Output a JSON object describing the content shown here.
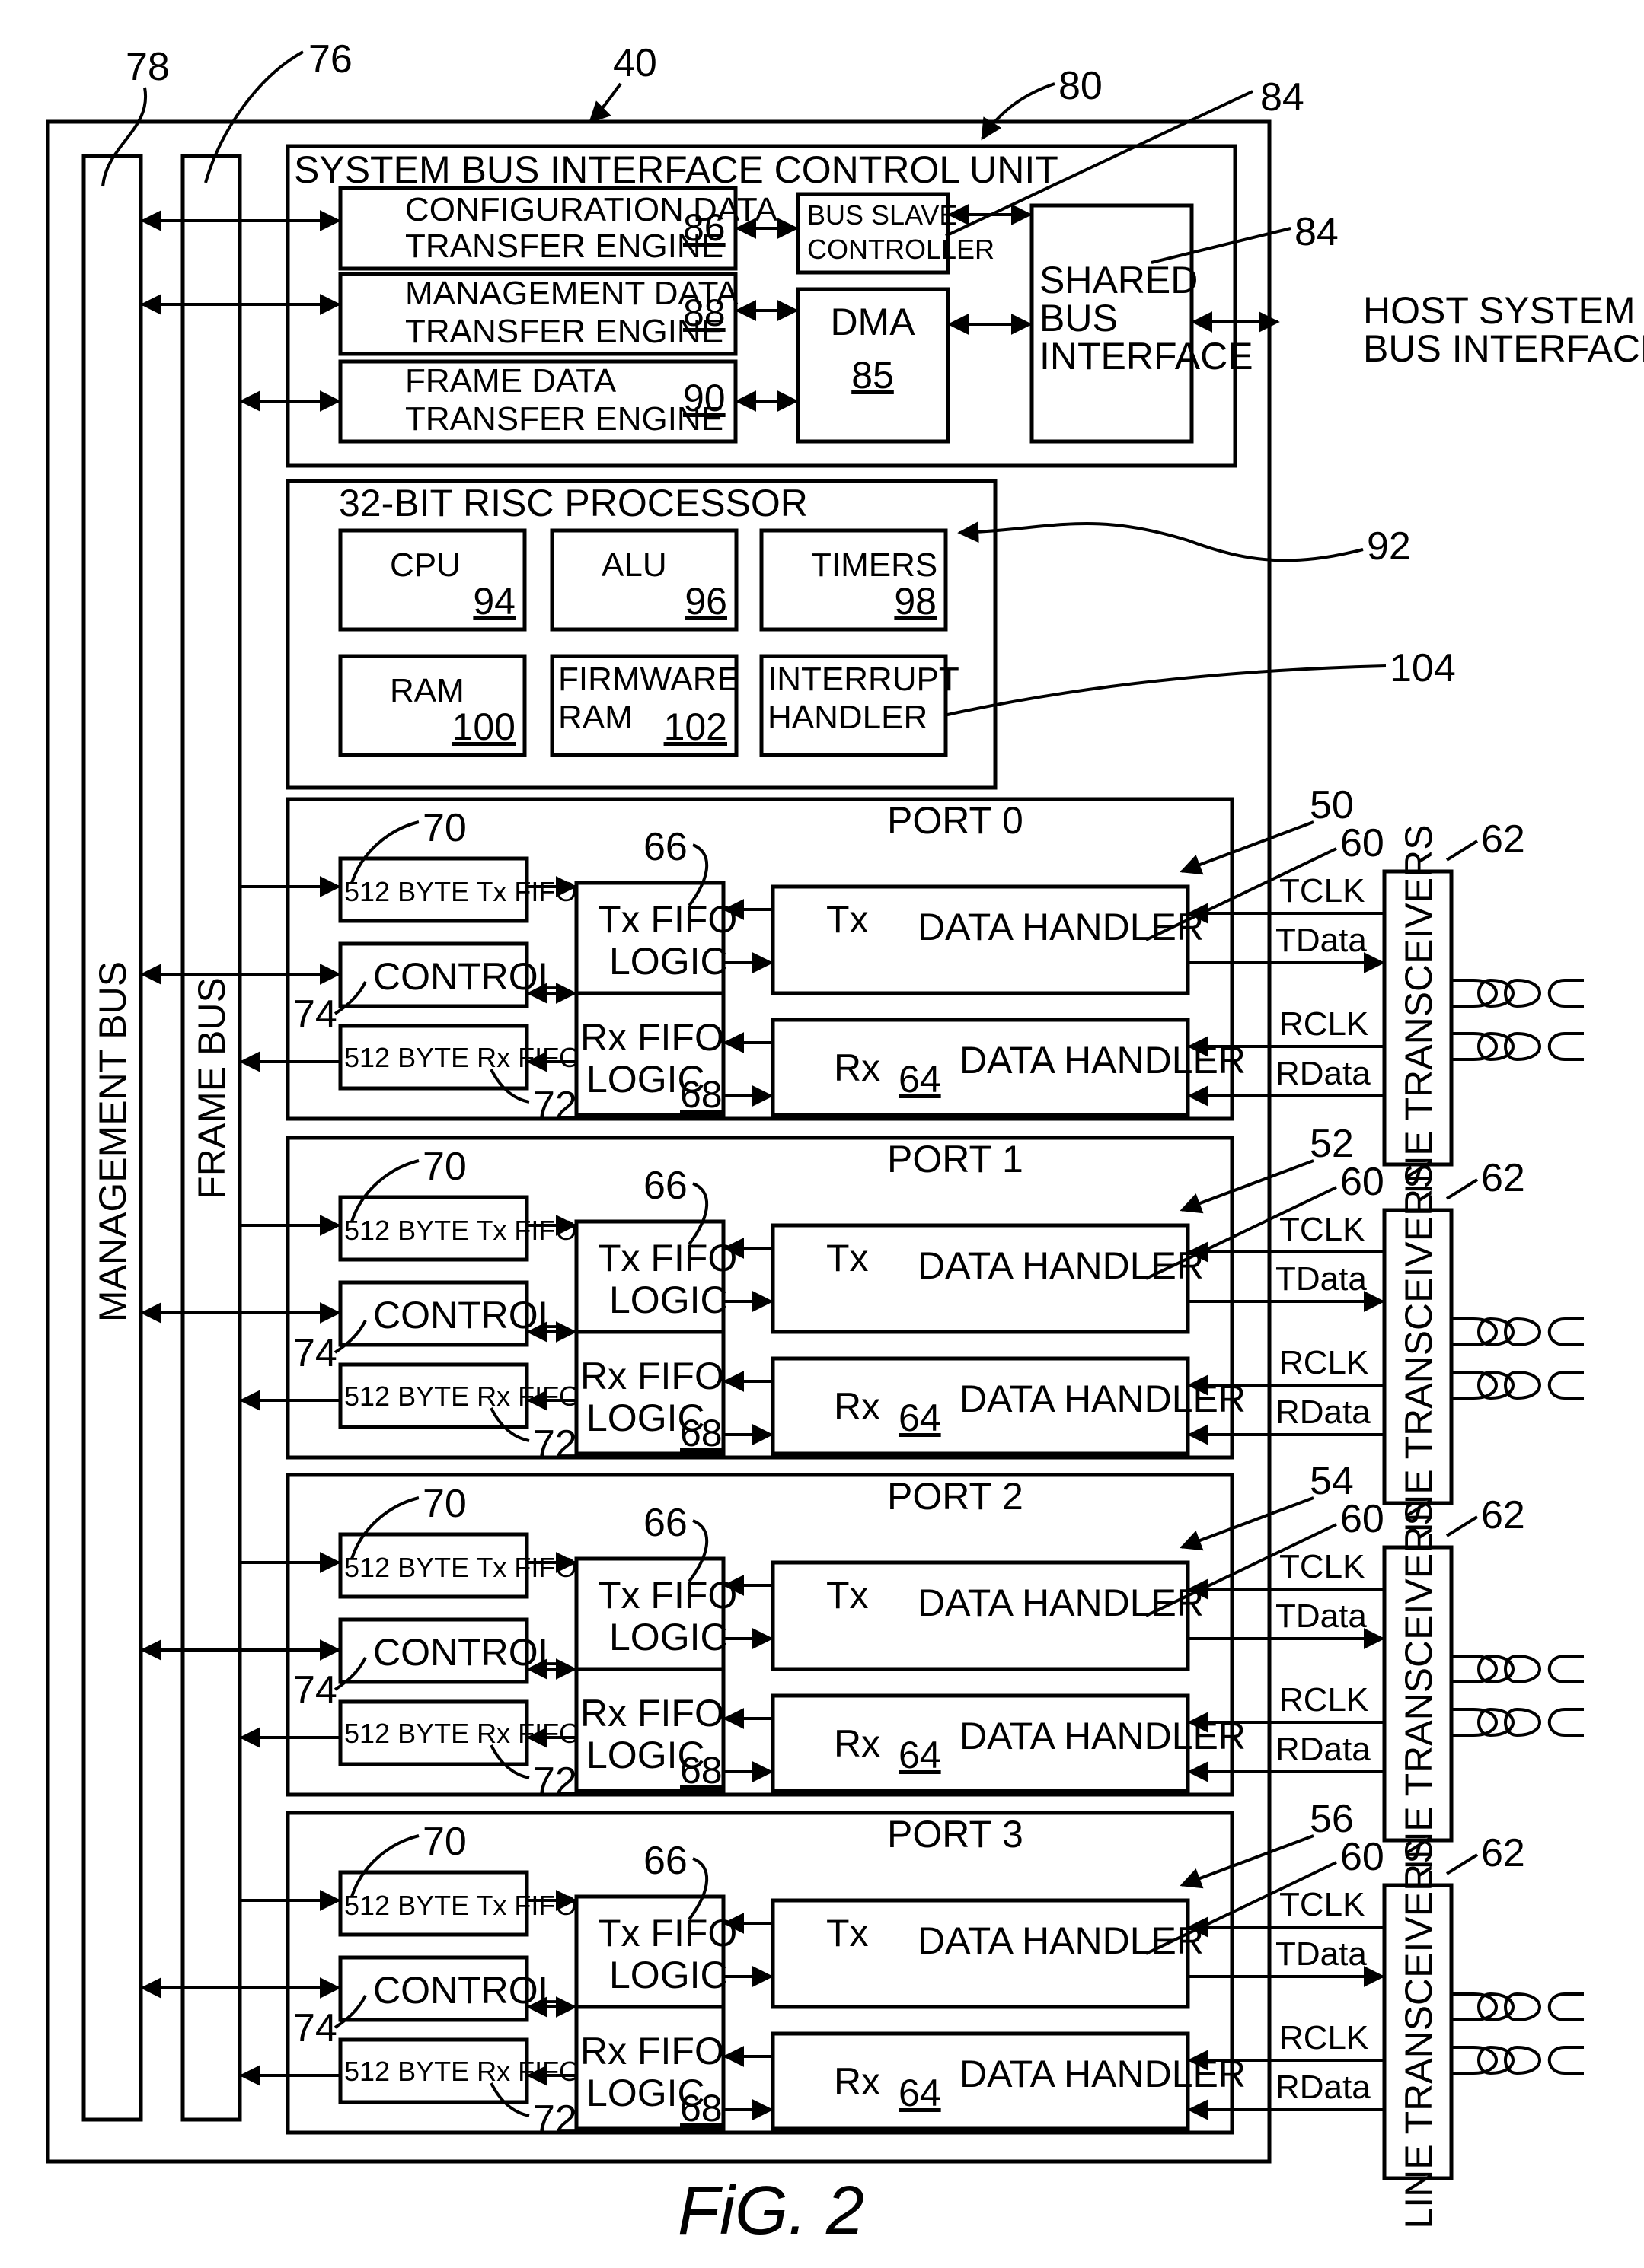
{
  "figure": {
    "caption": "FiG. 2",
    "chip_ref": "40"
  },
  "buses": {
    "management": {
      "label": "MANAGEMENT BUS",
      "ref": "78"
    },
    "frame": {
      "label": "FRAME BUS",
      "ref": "76"
    }
  },
  "sbic": {
    "title": "SYSTEM BUS INTERFACE CONTROL UNIT",
    "ref": "80",
    "engines": [
      {
        "line1": "CONFIGURATION DATA",
        "line2": "TRANSFER ENGINE",
        "num": "86"
      },
      {
        "line1": "MANAGEMENT DATA",
        "line2": "TRANSFER ENGINE",
        "num": "88"
      },
      {
        "line1": "FRAME DATA",
        "line2": "TRANSFER ENGINE",
        "num": "90"
      }
    ],
    "bus_slave": {
      "line1": "BUS SLAVE",
      "line2": "CONTROLLER",
      "ref": "84"
    },
    "dma": {
      "label": "DMA",
      "num": "85"
    },
    "shared_bus": {
      "line1": "SHARED",
      "line2": "BUS",
      "line3": "INTERFACE",
      "ref": "84"
    },
    "host": {
      "line1": "HOST SYSTEM",
      "line2": "BUS INTERFACE"
    }
  },
  "processor": {
    "title": "32-BIT RISC PROCESSOR",
    "ref": "92",
    "cells": [
      {
        "line1": "CPU",
        "line2": "",
        "num": "94"
      },
      {
        "line1": "ALU",
        "line2": "",
        "num": "96"
      },
      {
        "line1": "TIMERS",
        "line2": "",
        "num": "98"
      },
      {
        "line1": "RAM",
        "line2": "",
        "num": "100"
      },
      {
        "line1": "FIRMWARE",
        "line2": "RAM",
        "num": "102"
      },
      {
        "line1": "INTERRUPT",
        "line2": "HANDLER",
        "num": ""
      }
    ],
    "interrupt_ref": "104"
  },
  "ports": [
    {
      "title": "PORT 0",
      "ref": "50"
    },
    {
      "title": "PORT 1",
      "ref": "52"
    },
    {
      "title": "PORT 2",
      "ref": "54"
    },
    {
      "title": "PORT 3",
      "ref": "56"
    }
  ],
  "port_common": {
    "tx_fifo": "512 BYTE Tx FIFO",
    "tx_fifo_ref": "70",
    "control": "CONTROL",
    "control_ref": "74",
    "rx_fifo": "512 BYTE Rx FIFO",
    "rx_fifo_ref": "72",
    "tx_fifo_logic_1": "Tx FIFO",
    "tx_fifo_logic_2": "LOGIC",
    "tx_fifo_logic_ref": "66",
    "rx_fifo_logic_1": "Rx FIFO",
    "rx_fifo_logic_2": "LOGIC",
    "rx_fifo_logic_num": "68",
    "tx_handler_prefix": "Tx",
    "tx_handler_label": "DATA HANDLER",
    "tx_handler_ref": "60",
    "rx_handler_prefix": "Rx",
    "rx_handler_num": "64",
    "rx_handler_label": "DATA HANDLER",
    "tclk": "TCLK",
    "tdata": "TData",
    "rclk": "RCLK",
    "rdata": "RData",
    "transceiver": "LINE TRANSCEIVERS",
    "transceiver_ref": "62"
  }
}
